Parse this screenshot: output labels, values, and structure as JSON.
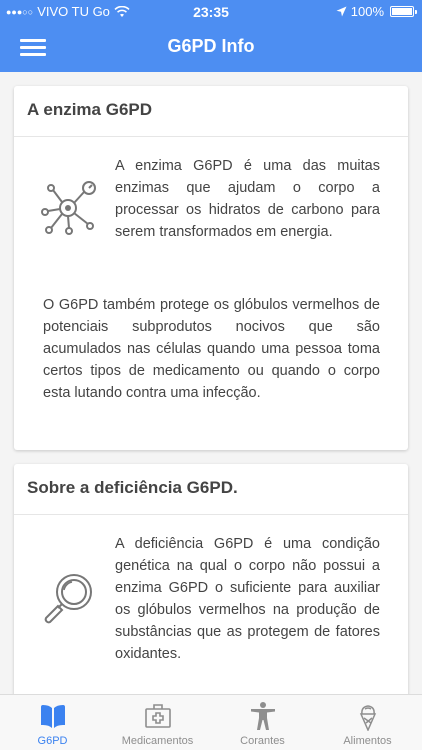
{
  "status_bar": {
    "carrier": "VIVO TU Go",
    "time": "23:35",
    "battery": "100%"
  },
  "header": {
    "title": "G6PD Info"
  },
  "cards": [
    {
      "title": "A enzima G6PD",
      "icon": "molecule-icon",
      "text1": "A enzima G6PD é uma das muitas enzimas que ajudam o corpo a processar os hidratos de carbono para serem transformados em energia.",
      "text2": "O G6PD também protege os glóbulos vermelhos de potenciais subprodutos nocivos que são acumulados nas células quando uma pessoa toma certos tipos de medicamento ou quando o corpo esta lutando contra uma infecção."
    },
    {
      "title": "Sobre a deficiência G6PD.",
      "icon": "magnifier-icon",
      "text1": "A deficiência G6PD é uma condição genética na qual o corpo não possui a enzima G6PD o suficiente para auxiliar os glóbulos vermelhos na produção de substâncias que as protegem de fatores oxidantes."
    }
  ],
  "tabs": [
    {
      "label": "G6PD",
      "icon": "book-icon",
      "active": true
    },
    {
      "label": "Medicamentos",
      "icon": "medkit-icon",
      "active": false
    },
    {
      "label": "Corantes",
      "icon": "person-icon",
      "active": false
    },
    {
      "label": "Alimentos",
      "icon": "ice-cream-icon",
      "active": false
    }
  ],
  "colors": {
    "accent": "#4d8ef2",
    "tab_active": "#3b82f0",
    "tab_inactive": "#8e8e8e",
    "text": "#444444",
    "icon_gray": "#777777"
  }
}
